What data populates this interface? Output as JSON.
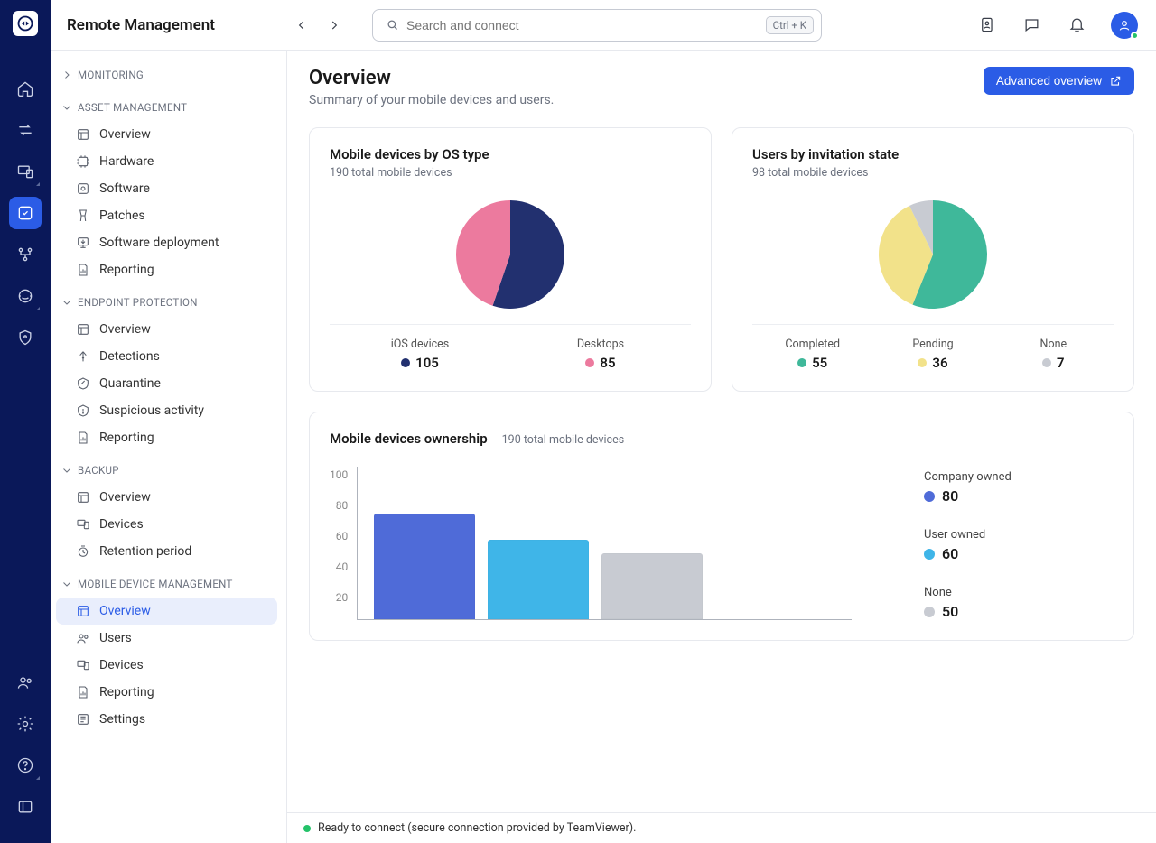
{
  "app_title": "Remote Management",
  "search": {
    "placeholder": "Search and connect",
    "shortcut": "Ctrl + K"
  },
  "page": {
    "title": "Overview",
    "subtitle": "Summary of your mobile devices and users.",
    "cta": "Advanced overview"
  },
  "sidebar": {
    "groups": [
      {
        "label": "MONITORING",
        "collapsed": true,
        "items": []
      },
      {
        "label": "ASSET MANAGEMENT",
        "collapsed": false,
        "items": [
          "Overview",
          "Hardware",
          "Software",
          "Patches",
          "Software deployment",
          "Reporting"
        ]
      },
      {
        "label": "ENDPOINT PROTECTION",
        "collapsed": false,
        "items": [
          "Overview",
          "Detections",
          "Quarantine",
          "Suspicious activity",
          "Reporting"
        ]
      },
      {
        "label": "BACKUP",
        "collapsed": false,
        "items": [
          "Overview",
          "Devices",
          "Retention period"
        ]
      },
      {
        "label": "MOBILE DEVICE MANAGEMENT",
        "collapsed": false,
        "items": [
          "Overview",
          "Users",
          "Devices",
          "Reporting",
          "Settings"
        ],
        "active": "Overview"
      }
    ]
  },
  "status_bar": "Ready to connect (secure connection provided by TeamViewer).",
  "cards": {
    "os": {
      "title": "Mobile devices by OS type",
      "sub": "190 total mobile devices",
      "legend": [
        {
          "label": "iOS devices",
          "value": "105",
          "color": "#22306f"
        },
        {
          "label": "Desktops",
          "value": "85",
          "color": "#ec7a9e"
        }
      ]
    },
    "invite": {
      "title": "Users by invitation state",
      "sub": "98 total mobile devices",
      "legend": [
        {
          "label": "Completed",
          "value": "55",
          "color": "#3fb89a"
        },
        {
          "label": "Pending",
          "value": "36",
          "color": "#f2e28a"
        },
        {
          "label": "None",
          "value": "7",
          "color": "#c8cbd2"
        }
      ]
    },
    "ownership": {
      "title": "Mobile devices ownership",
      "sub": "190 total mobile devices",
      "y_ticks": [
        "100",
        "80",
        "60",
        "40",
        "20"
      ],
      "legend": [
        {
          "label": "Company owned",
          "value": "80",
          "color": "#4f6bd8"
        },
        {
          "label": "User owned",
          "value": "60",
          "color": "#3fb5e8"
        },
        {
          "label": "None",
          "value": "50",
          "color": "#c8cbd2"
        }
      ]
    }
  },
  "chart_data": [
    {
      "type": "pie",
      "title": "Mobile devices by OS type",
      "total": 190,
      "series": [
        {
          "name": "iOS devices",
          "value": 105,
          "color": "#22306f"
        },
        {
          "name": "Desktops",
          "value": 85,
          "color": "#ec7a9e"
        }
      ]
    },
    {
      "type": "pie",
      "title": "Users by invitation state",
      "total": 98,
      "series": [
        {
          "name": "Completed",
          "value": 55,
          "color": "#3fb89a"
        },
        {
          "name": "Pending",
          "value": 36,
          "color": "#f2e28a"
        },
        {
          "name": "None",
          "value": 7,
          "color": "#c8cbd2"
        }
      ]
    },
    {
      "type": "bar",
      "title": "Mobile devices ownership",
      "ylabel": "",
      "ylim": [
        0,
        100
      ],
      "categories": [
        "Company owned",
        "User owned",
        "None"
      ],
      "values": [
        80,
        60,
        50
      ],
      "colors": [
        "#4f6bd8",
        "#3fb5e8",
        "#c8cbd2"
      ]
    }
  ]
}
